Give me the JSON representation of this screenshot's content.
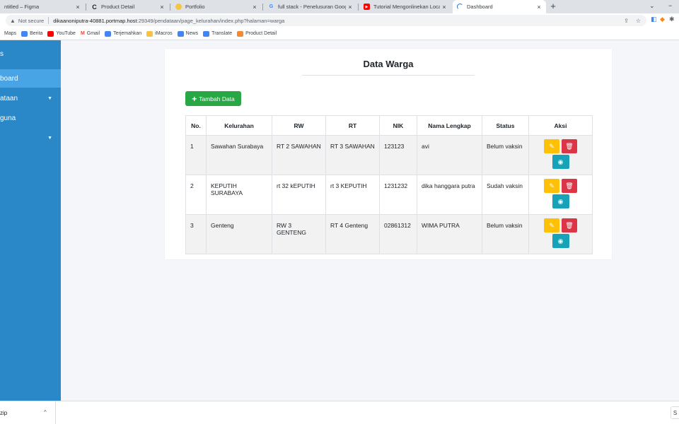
{
  "browser": {
    "tabs": [
      {
        "title": "ntitled – Figma",
        "icon": "figma-icon"
      },
      {
        "title": "Product Detail",
        "icon": "c-logo-icon"
      },
      {
        "title": "Portfolio",
        "icon": "portfolio-icon"
      },
      {
        "title": "full stack - Penelusuran Google",
        "icon": "google-icon"
      },
      {
        "title": "Tutorial Mengonlinekan Localho...",
        "icon": "youtube-icon"
      },
      {
        "title": "Dashboard",
        "icon": "loading-icon",
        "active": true
      }
    ],
    "close_glyph": "×",
    "new_tab_glyph": "+",
    "address": {
      "security": "Not secure",
      "host": "dikaanoniputra-40881.portmap.host",
      "path": ":29349/pendataan/page_kelurahan/index.php?halaman=warga"
    },
    "bookmarks": [
      {
        "label": "Maps",
        "color": ""
      },
      {
        "label": "Berita",
        "color": "#4285f4"
      },
      {
        "label": "YouTube",
        "color": "#ff0000"
      },
      {
        "label": "Gmail",
        "color": "#ea4335"
      },
      {
        "label": "Terjemahkan",
        "color": "#4285f4"
      },
      {
        "label": "iMacros",
        "color": "#f6c342"
      },
      {
        "label": "News",
        "color": "#4285f4"
      },
      {
        "label": "Translate",
        "color": "#4285f4"
      },
      {
        "label": "Product Detail",
        "color": "#f28b30"
      }
    ]
  },
  "sidebar": {
    "brand": "s",
    "items": [
      {
        "label": "board",
        "active": true,
        "caret": false
      },
      {
        "label": "ataan",
        "active": false,
        "caret": true
      },
      {
        "label": "guna",
        "active": false,
        "caret": false
      },
      {
        "label": "",
        "active": false,
        "caret": true
      }
    ]
  },
  "main": {
    "title": "Data Warga",
    "add_button": "Tambah Data",
    "columns": [
      "No.",
      "Kelurahan",
      "RW",
      "RT",
      "NIK",
      "Nama Lengkap",
      "Status",
      "Aksi"
    ],
    "rows": [
      {
        "no": "1",
        "kelurahan": "Sawahan Surabaya",
        "rw": "RT 2 SAWAHAN",
        "rt": "RT 3 SAWAHAN",
        "nik": "123123",
        "nama": "avi",
        "status": "Belum vaksin"
      },
      {
        "no": "2",
        "kelurahan": "KEPUTIH SURABAYA",
        "rw": "rt 32 kEPUTIH",
        "rt": "rt 3 KEPUTIH",
        "nik": "1231232",
        "nama": "dika hanggara putra",
        "status": "Sudah vaksin"
      },
      {
        "no": "3",
        "kelurahan": "Genteng",
        "rw": "RW 3 GENTENG",
        "rt": "RT 4 Genteng",
        "nik": "02861312",
        "nama": "WIMA PUTRA",
        "status": "Belum vaksin"
      }
    ],
    "colors": {
      "add": "#28a745",
      "edit": "#ffc107",
      "delete": "#dc3545",
      "view": "#17a2b8",
      "sidebar": "#2a87c8"
    }
  },
  "downloads": {
    "file": "zip"
  }
}
